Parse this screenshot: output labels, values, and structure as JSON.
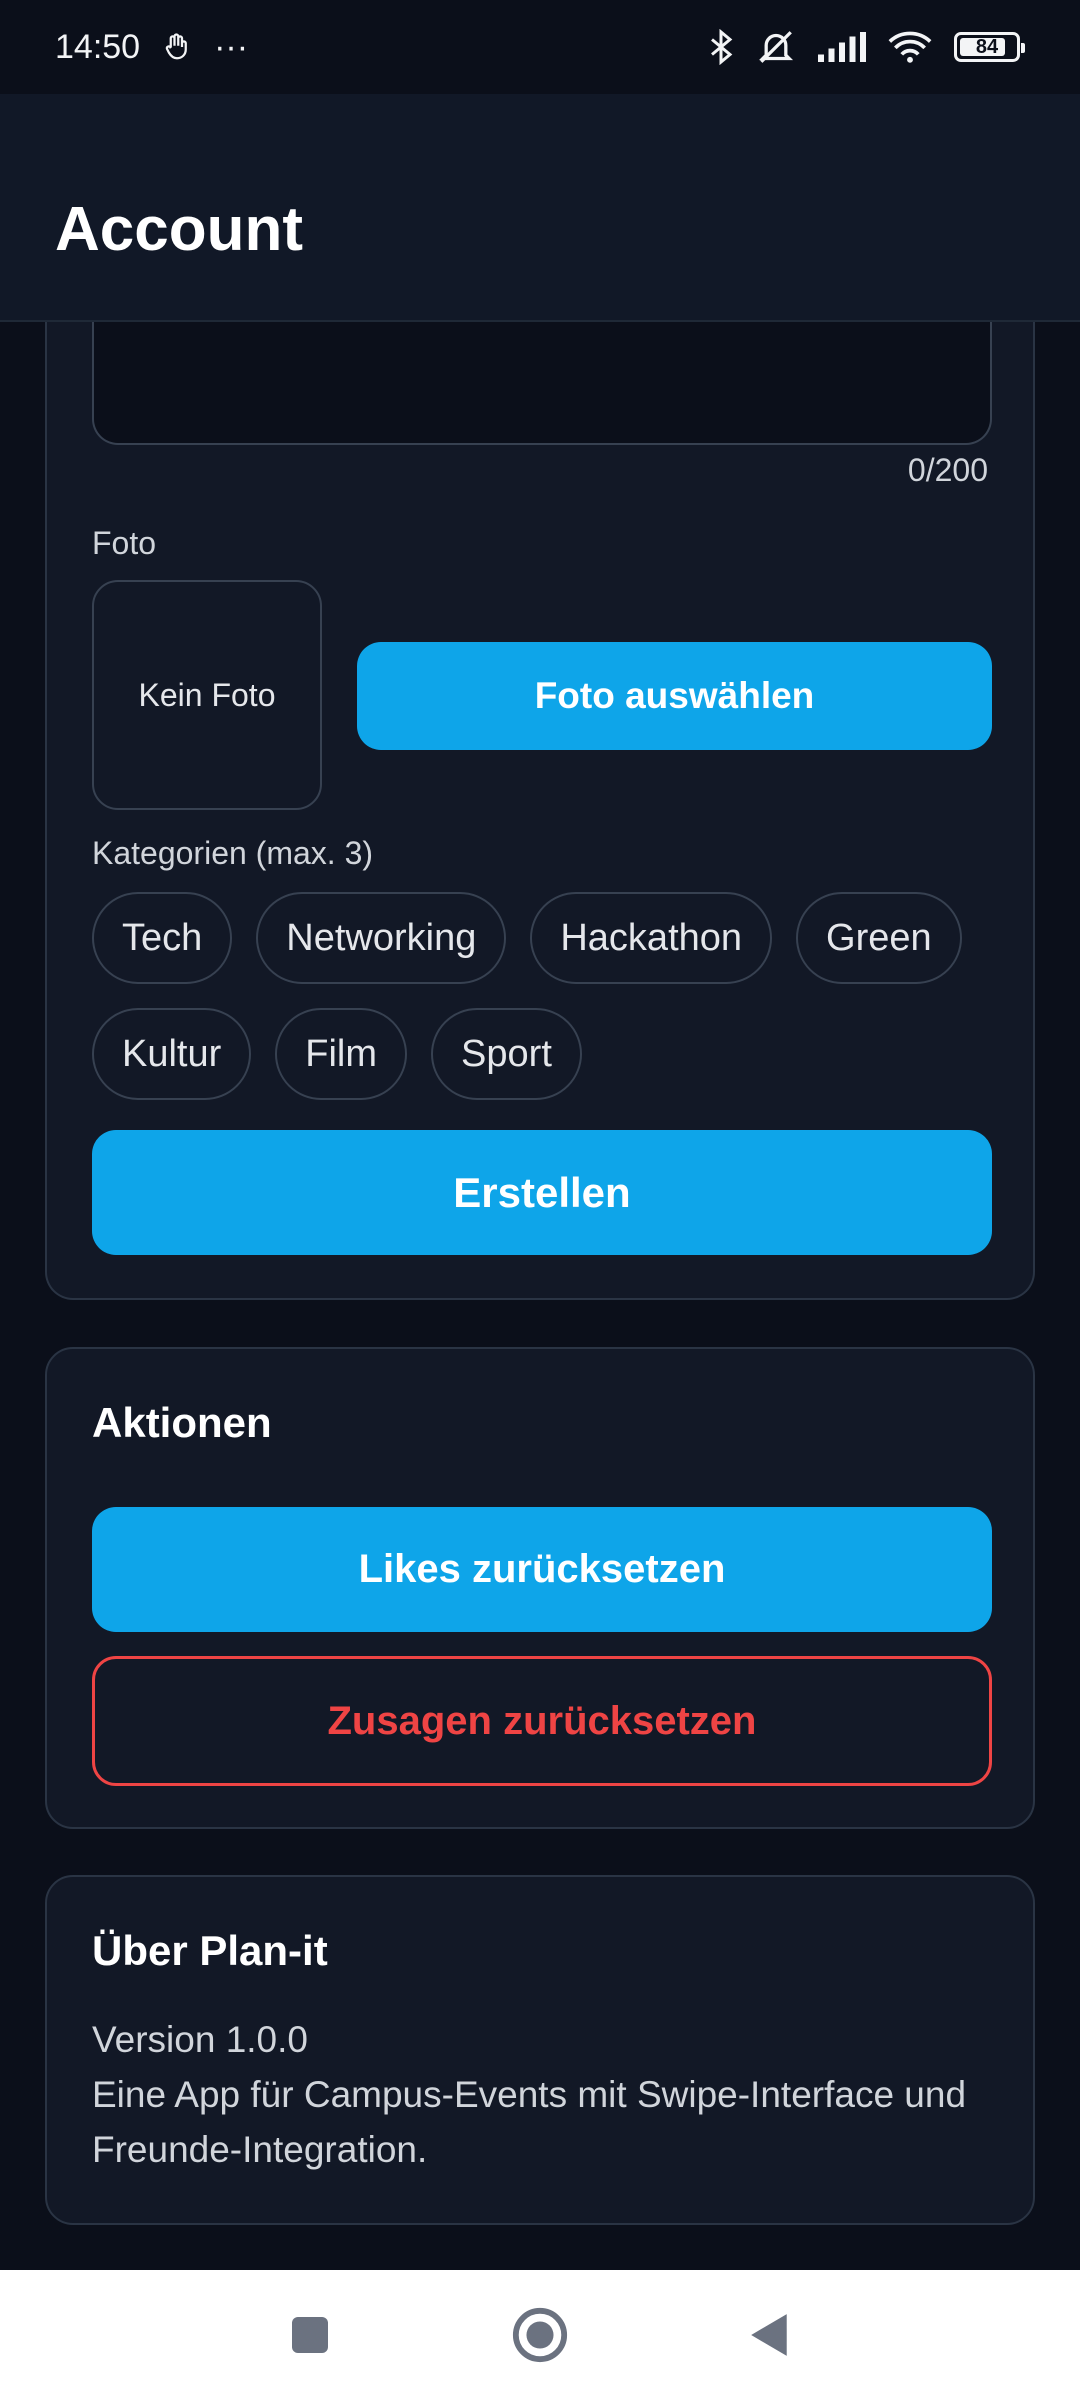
{
  "status_bar": {
    "time": "14:50",
    "dots": "···",
    "battery": "84",
    "icons": [
      "gesture-icon",
      "bluetooth-icon",
      "mute-icon",
      "signal-icon",
      "wifi-icon",
      "battery-icon"
    ]
  },
  "app_bar": {
    "title": "Account"
  },
  "form": {
    "char_counter": "0/200",
    "photo_label": "Foto",
    "photo_placeholder": "Kein Foto",
    "choose_photo_button": "Foto auswählen",
    "categories_label": "Kategorien (max. 3)",
    "categories": [
      [
        "Tech",
        "Networking",
        "Hackathon",
        "Green"
      ],
      [
        "Kultur",
        "Film",
        "Sport"
      ]
    ],
    "create_button": "Erstellen"
  },
  "actions": {
    "title": "Aktionen",
    "reset_likes_button": "Likes zurücksetzen",
    "reset_commitments_button": "Zusagen zurücksetzen"
  },
  "about": {
    "title": "Über Plan-it",
    "version": "Version 1.0.0",
    "description": "Eine App für Campus-Events mit Swipe-Interface und Freunde-Integration."
  },
  "colors": {
    "accent": "#0ea5e9",
    "danger": "#ef4444",
    "background": "#0b0f1a",
    "card": "#121826"
  },
  "nav_bar": {
    "icons": [
      "recents-icon",
      "home-icon",
      "back-icon"
    ]
  }
}
